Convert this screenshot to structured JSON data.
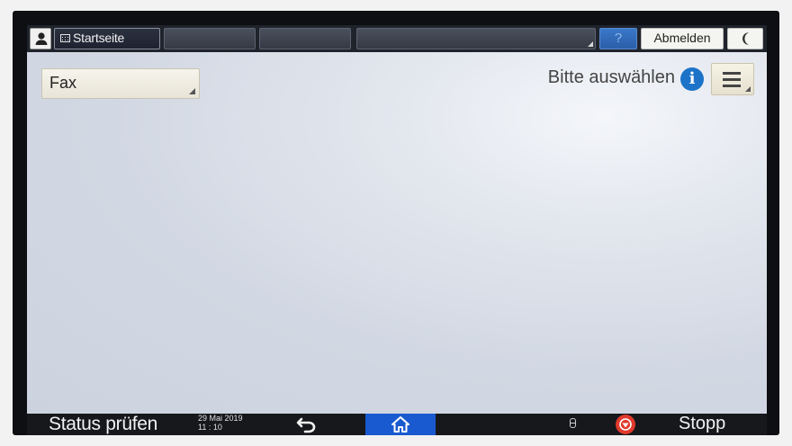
{
  "topbar": {
    "user_icon": "user-icon",
    "home_tab_label": "Startseite",
    "home_tab_icon": "keyboard-icon",
    "help_label": "?",
    "logout_label": "Abmelden",
    "sleep_icon": "moon-icon"
  },
  "main": {
    "select_value": "Fax",
    "prompt": "Bitte auswählen",
    "info_icon": "info-icon",
    "menu_icon": "hamburger-menu-icon"
  },
  "bottombar": {
    "status_label": "Status prüfen",
    "date": "29 Mai 2019",
    "time": "11 : 10",
    "back_icon": "back-arrow-icon",
    "home_icon": "home-icon",
    "storage_icon": "storage-icon",
    "stop_icon": "stop-icon",
    "stop_label": "Stopp"
  },
  "colors": {
    "home_button": "#1a5ad0",
    "stop_button": "#e03a2c",
    "info_icon": "#1c73c8"
  }
}
